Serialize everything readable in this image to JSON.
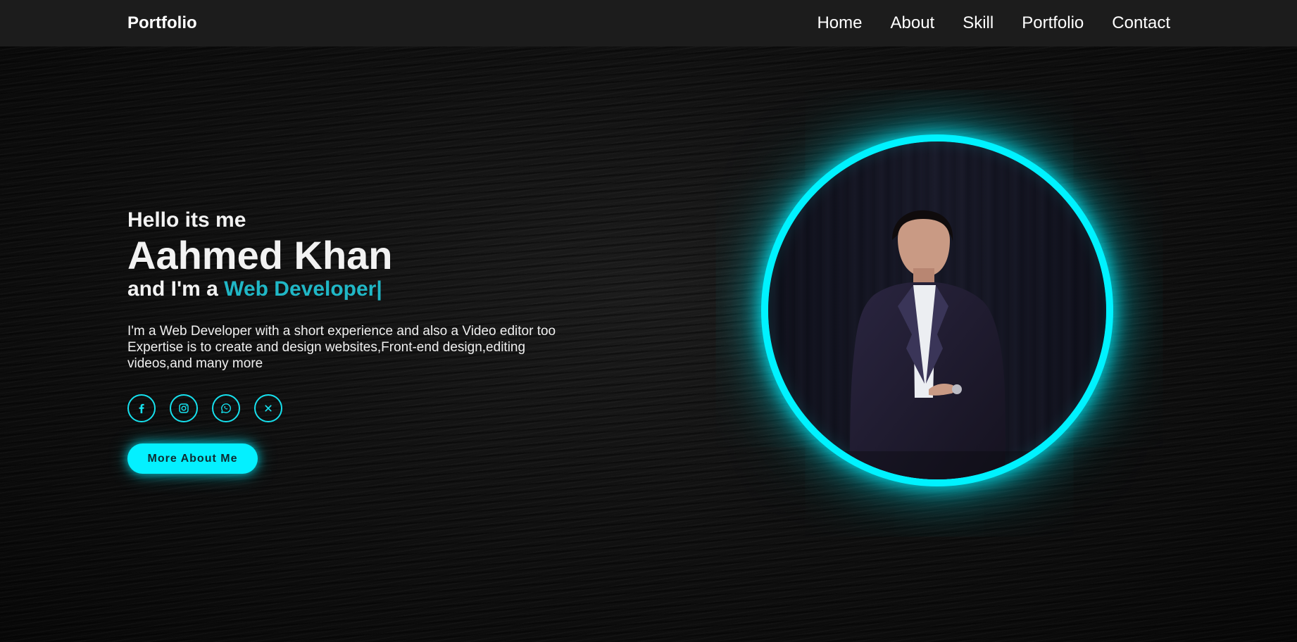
{
  "header": {
    "logo": "Portfolio",
    "nav": [
      {
        "label": "Home"
      },
      {
        "label": "About"
      },
      {
        "label": "Skill"
      },
      {
        "label": "Portfolio"
      },
      {
        "label": "Contact"
      }
    ]
  },
  "hero": {
    "greeting": "Hello its me",
    "name": "Aahmed Khan",
    "role_prefix": "and I'm a ",
    "role": "Web Developer|",
    "description_line1": "I'm a Web Developer with a short experience and also a Video editor too",
    "description_line2": "Expertise is to create and design websites,Front-end design,editing videos,and many more",
    "cta_label": "More About Me",
    "socials": [
      {
        "icon": "facebook-icon"
      },
      {
        "icon": "instagram-icon"
      },
      {
        "icon": "whatsapp-icon"
      },
      {
        "icon": "x-icon"
      }
    ]
  },
  "colors": {
    "accent": "#04f0ff",
    "role_text": "#20b7c6",
    "header_bg": "#1c1c1c",
    "page_bg": "#0a0a0a"
  }
}
